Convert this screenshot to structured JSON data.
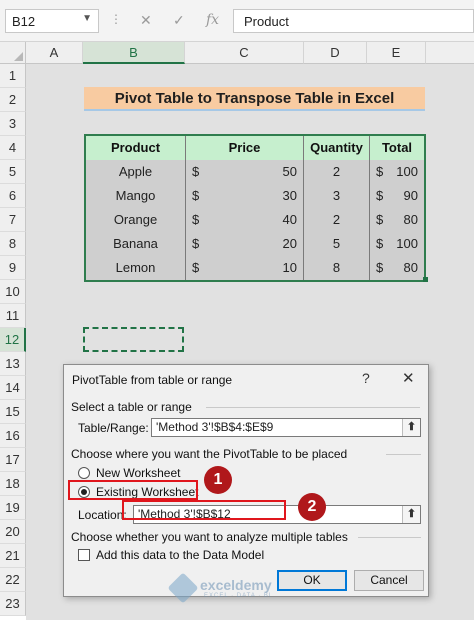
{
  "formula_bar": {
    "name_box": "B12",
    "formula": "Product",
    "cancel_glyph": "✕",
    "enter_glyph": "✓",
    "fx_glyph": "fx"
  },
  "columns": [
    "A",
    "B",
    "C",
    "D",
    "E"
  ],
  "rows": [
    "1",
    "2",
    "3",
    "4",
    "5",
    "6",
    "7",
    "8",
    "9",
    "10",
    "11",
    "12",
    "13",
    "14",
    "15",
    "16",
    "17",
    "18",
    "19",
    "20",
    "21",
    "22",
    "23"
  ],
  "sheet_title": "Pivot Table to Transpose Table in Excel",
  "table": {
    "headers": [
      "Product",
      "Price",
      "Quantity",
      "Total"
    ],
    "currency": "$",
    "rows": [
      {
        "product": "Apple",
        "price": "50",
        "quantity": "2",
        "total": "100"
      },
      {
        "product": "Mango",
        "price": "30",
        "quantity": "3",
        "total": "90"
      },
      {
        "product": "Orange",
        "price": "40",
        "quantity": "2",
        "total": "80"
      },
      {
        "product": "Banana",
        "price": "20",
        "quantity": "5",
        "total": "100"
      },
      {
        "product": "Lemon",
        "price": "10",
        "quantity": "8",
        "total": "80"
      }
    ]
  },
  "dialog": {
    "title": "PivotTable from table or range",
    "help": "?",
    "close": "✕",
    "section_select": "Select a table or range",
    "table_range_label": "Table/Range:",
    "table_range_value": "'Method 3'!$B$4:$E$9",
    "section_place": "Choose where you want the PivotTable to be placed",
    "new_worksheet": "New Worksheet",
    "existing_worksheet": "Existing Worksheet",
    "location_label": "Location:",
    "location_value": "'Method 3'!$B$12",
    "section_multi": "Choose whether you want to analyze multiple tables",
    "data_model": "Add this data to the Data Model",
    "ok": "OK",
    "cancel": "Cancel"
  },
  "badges": [
    "1",
    "2"
  ],
  "watermark": {
    "name": "exceldemy",
    "tagline": "EXCEL · DATA · BI"
  },
  "colors": {
    "excel_green": "#217346",
    "title_fill": "#f8cba1",
    "header_fill": "#c6efce",
    "highlight_red": "#e0161d"
  }
}
